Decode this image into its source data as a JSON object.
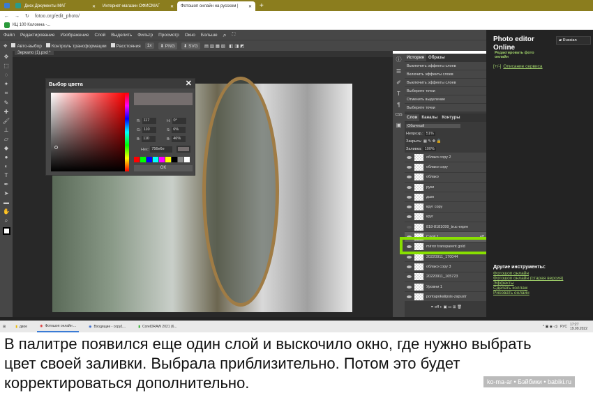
{
  "browser": {
    "tabs": [
      {
        "label": "Диск Документы МАГ"
      },
      {
        "label": "Интернет-магазин ОФИСМАГ"
      },
      {
        "label": "Фотошоп онлайн на русском |"
      }
    ],
    "new_tab": "+",
    "url": "fotoo.org/edit_photo/",
    "bookmark": "КЦ 100 Коломна -..."
  },
  "menu": [
    "Файл",
    "Редактирование",
    "Изображение",
    "Слой",
    "Выделить",
    "Фильтр",
    "Просмотр",
    "Окно",
    "Больше"
  ],
  "options": {
    "auto_select": "Авто-выбор",
    "transform": "Контроль трансформации",
    "distances": "Расстояния",
    "zoom": "1x",
    "png": "PNG",
    "svg": "SVG"
  },
  "document_tab": "Зеркало (1).psd *",
  "color_picker": {
    "title": "Выбор цвета",
    "close": "✕",
    "R": "117",
    "G": "110",
    "B": "110",
    "H": "0°",
    "S": "6%",
    "Br": "46%",
    "hex_label": "Hex:",
    "hex": "756e6e",
    "ok": "OK",
    "labels": {
      "r": "R:",
      "g": "G:",
      "b": "B:",
      "h": "H:",
      "s": "S:",
      "br": "B:"
    },
    "swatches": [
      "#ff0000",
      "#00ff00",
      "#0000ff",
      "#00ffff",
      "#ff00ff",
      "#ffff00",
      "#000000",
      "#888888",
      "#ffffff"
    ],
    "preview_color": "#756e6e"
  },
  "history": {
    "tabs": [
      "История",
      "Образы"
    ],
    "items": [
      "Выключить эффекты слоев",
      "Включить эффекты слоев",
      "Выключить эффекты слоев",
      "Выберите точки",
      "Отменить выделение",
      "Выберите точки"
    ]
  },
  "layers": {
    "tabs": [
      "Слои",
      "Каналы",
      "Контуры"
    ],
    "blend": "Обычный",
    "opacity_label": "Непрозр.:",
    "opacity": "51%",
    "lock_label": "Закрыть:",
    "fill_label": "Заливка:",
    "fill": "100%",
    "items": [
      "облако copy 2",
      "облако copy",
      "облако",
      "руки",
      "дым",
      "круг copy",
      "круг",
      "818-8181099_truc-expre",
      "Слой 1",
      "mirror transparent gold",
      "20220911_170044",
      "облако copy 3",
      "20220911_165723",
      "Уровни 1",
      "pontapokalipsis-zapustr"
    ],
    "selected": "Слой 1",
    "selected_badge": "eff",
    "hidden": [
      "818-8181099_truc-expre"
    ]
  },
  "sidebar": {
    "title": "Photo editor Online",
    "subtitle": "Редактировать фото онлайн",
    "language": "Russian",
    "toggle": "[+/-]",
    "description_link": "Описание сервиса",
    "other_title": "Другие инструменты:",
    "links": [
      "Фотошоп онлайн",
      "Фотошоп онлайн (старая версия)",
      "Эффекты",
      "Сделать коллаж",
      "Рисовать онлайн"
    ]
  },
  "taskbar": {
    "items": [
      "двое",
      "Фотошоп онлайн ...",
      "Входящие - copy1...",
      "CorelDRAW 2021 (6..."
    ],
    "lang": "РУС",
    "time": "17:27",
    "date": "19.09.2022"
  },
  "caption": "В палитре появился еще один слой и выскочило окно, где нужно выбрать цвет своей заливки. Выбрала приблизительно. Потом это будет корректироваться дополнительно.",
  "watermark": "ko-ma-ar • Бэйбики • babiki.ru",
  "colors": {
    "highlight": "#88e000",
    "link": "#9fd06a"
  }
}
